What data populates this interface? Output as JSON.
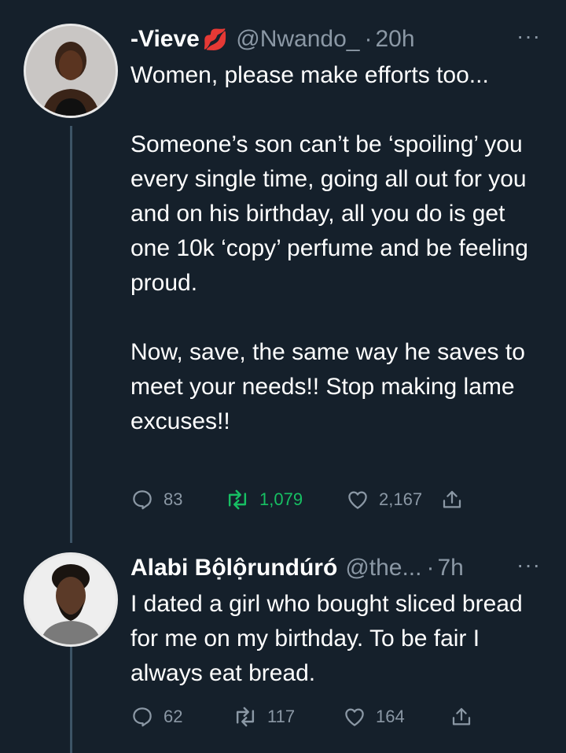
{
  "tweets": [
    {
      "name": "-Vieve",
      "emoji": "💋",
      "handle": "@Nwando_",
      "time": "20h",
      "text": [
        "Women, please make efforts too...",
        "Someone’s son can’t be ‘spoiling’ you every single time, going all out for you and on his birthday, all you do is get one 10k ‘copy’ perfume and be feeling proud.",
        "Now, save, the same way he saves to meet your needs!! Stop making lame excuses!!"
      ],
      "replies": "83",
      "retweets": "1,079",
      "likes": "2,167"
    },
    {
      "name": "Alabi Bộlộrundúró",
      "handle": "@the...",
      "time": "7h",
      "text": [
        "I dated a girl who bought sliced bread for me on my birthday. To be fair I always eat bread."
      ],
      "replies": "62",
      "retweets": "117",
      "likes": "164"
    }
  ],
  "more_label": "···",
  "dot": "·",
  "colors": {
    "background": "#15202b",
    "secondary_text": "#8b98a5",
    "retweet_active": "#17bf63",
    "thread_line": "#3d5466"
  },
  "icons": [
    "avatar",
    "kiss-mark-emoji",
    "more-icon",
    "reply-icon",
    "retweet-icon",
    "like-icon",
    "share-icon"
  ]
}
